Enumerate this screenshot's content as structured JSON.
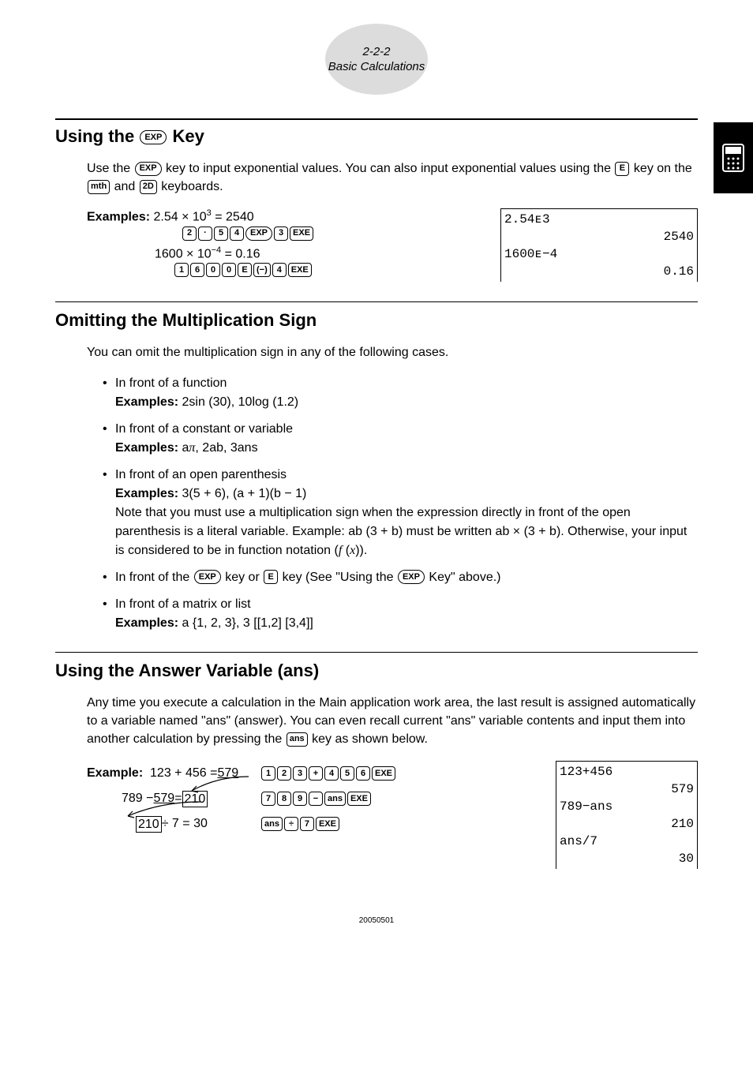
{
  "header": {
    "pagenum": "2-2-2",
    "title": "Basic Calculations"
  },
  "section_exp": {
    "heading": "Using the EXP Key",
    "intro_a": "Use the ",
    "intro_b": " key to input exponential values. You can also input exponential values using the ",
    "intro_c": " key on the ",
    "intro_d": " and ",
    "intro_e": " keyboards.",
    "examples_label": "Examples:",
    "ex1": "2.54 × 10³ = 2540",
    "ex2": "1600 × 10⁻⁴ = 0.16",
    "keys": {
      "seq1": [
        "2",
        "·",
        "5",
        "4",
        "EXP",
        "3",
        "EXE"
      ],
      "seq2": [
        "1",
        "6",
        "0",
        "0",
        "E",
        "(−)",
        "4",
        "EXE"
      ]
    },
    "screen": {
      "l1": "2.54ᴇ3",
      "r1": "2540",
      "l2": "1600ᴇ−4",
      "r2": "0.16"
    }
  },
  "section_omit": {
    "heading": "Omitting the Multiplication Sign",
    "intro": "You can omit the multiplication sign in any of the following cases.",
    "items": [
      {
        "lead": "In front of a function",
        "exlabel": "Examples:",
        "ex": "2sin (30), 10log (1.2)"
      },
      {
        "lead": "In front of a constant or variable",
        "exlabel": "Examples:",
        "ex": "aπ, 2ab, 3ans"
      },
      {
        "lead": "In front of an open parenthesis",
        "exlabel": "Examples:",
        "ex": "3(5 + 6), (a + 1)(b − 1)",
        "note": "Note that you must use a multiplication sign when the expression directly in front of the open parenthesis is a literal variable. Example: ab (3 + b) must be written ab × (3 + b). Otherwise, your input is considered to be in function notation (",
        "note_tail": ")."
      },
      {
        "lead_a": "In front of the ",
        "lead_b": " key or ",
        "lead_c": " key (See \"Using the ",
        "lead_d": " Key\" above.)"
      },
      {
        "lead": "In front of a matrix or list",
        "exlabel": "Examples:",
        "ex": "a {1, 2, 3}, 3 [[1,2] [3,4]]"
      }
    ]
  },
  "section_ans": {
    "heading": "Using the Answer Variable (ans)",
    "intro_a": "Any time you execute a calculation in the Main application work area, the last result is assigned automatically to a variable named \"ans\" (answer). You can even recall current \"ans\" variable contents and input them into another calculation by pressing the ",
    "intro_b": " key as shown below.",
    "example_label": "Example:",
    "eq1_a": "123 + 456 = ",
    "eq1_b": "579",
    "eq2_a": "789 − ",
    "eq2_b": "579",
    "eq2_c": " = ",
    "eq2_d": "210",
    "eq3_a": "210",
    "eq3_b": " ÷ 7 = 30",
    "seq1": [
      "1",
      "2",
      "3",
      "+",
      "4",
      "5",
      "6",
      "EXE"
    ],
    "seq2": [
      "7",
      "8",
      "9",
      "−",
      "ans",
      "EXE"
    ],
    "seq3": [
      "ans",
      "÷",
      "7",
      "EXE"
    ],
    "screen": {
      "l1": "123+456",
      "r1": "579",
      "l2": "789−ans",
      "r2": "210",
      "l3": "ans/7",
      "r3": "30"
    }
  },
  "footer": "20050501"
}
